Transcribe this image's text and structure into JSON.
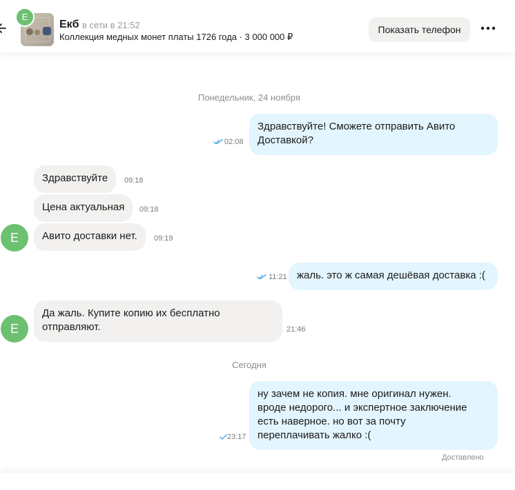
{
  "header": {
    "user_initial": "Е",
    "user_name": "Екб",
    "online_status": "в сети в 21:52",
    "listing_title": "Коллекция медных монет платы 1726 года · 3 000 000 ₽",
    "show_phone_label": "Показать телефон"
  },
  "chat": {
    "date_separators": [
      "Понедельник, 24 ноября",
      "Сегодня"
    ],
    "avatar_initial": "Е",
    "messages": [
      {
        "direction": "outgoing",
        "text": "Здравствуйте! Сможете отправить Авито",
        "text2": "Доставкой?",
        "time": "02:08",
        "read": true
      },
      {
        "direction": "incoming",
        "text": "Здравствуйте",
        "time": "09:18"
      },
      {
        "direction": "incoming",
        "text": "Цена актуальная",
        "time": "09:18"
      },
      {
        "direction": "incoming",
        "text": "Авито доставки нет.",
        "time": "09:19"
      },
      {
        "direction": "outgoing",
        "text": "жаль. это ж самая дешёвая доставка :(",
        "time": "11:21",
        "read": true
      },
      {
        "direction": "incoming",
        "text": "Да жаль. Купите копию их бесплатно",
        "text2": "отправляют.",
        "time": "21:46"
      },
      {
        "direction": "outgoing",
        "text": "ну зачем не копия. мне оригинал нужен.",
        "text2": "вроде недорого... и экспертное заключение",
        "text3": "есть наверное. но вот за почту",
        "text4": "переплачивать жалко :(",
        "time": "23:17",
        "read": false
      }
    ],
    "delivered_label": "Доставлено"
  },
  "colors": {
    "accent_green": "#6cc070",
    "outgoing_bubble": "#e3f5fe",
    "incoming_bubble": "#f2f1ef",
    "read_check": "#3aa0e8"
  },
  "icons": [
    "back-arrow-icon",
    "more-icon",
    "double-check-icon",
    "single-check-icon"
  ]
}
